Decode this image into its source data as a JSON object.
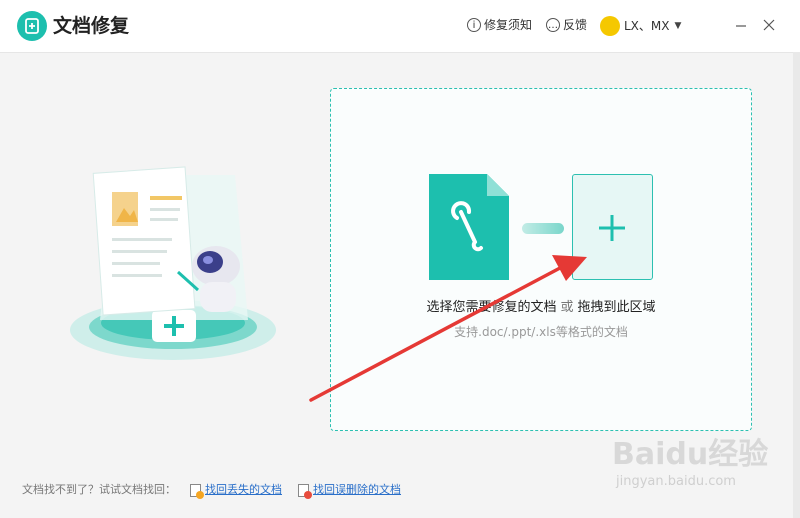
{
  "app": {
    "title": "文档修复"
  },
  "header": {
    "guide_label": "修复须知",
    "feedback_label": "反馈",
    "user_name": "LX、MX"
  },
  "dropzone": {
    "prompt_select": "选择您需要修复的文档",
    "prompt_or": "或",
    "prompt_drag": "拖拽到此区域",
    "hint": "支持.doc/.ppt/.xls等格式的文档"
  },
  "footer": {
    "question": "文档找不到了？试试文档找回：",
    "link_lost": "找回丢失的文档",
    "link_deleted": "找回误删除的文档"
  },
  "watermark": {
    "brand": "Baidu经验",
    "url": "jingyan.baidu.com"
  },
  "colors": {
    "accent": "#1dbfae",
    "link": "#2a6fc9",
    "annotation_arrow": "#e53935"
  }
}
